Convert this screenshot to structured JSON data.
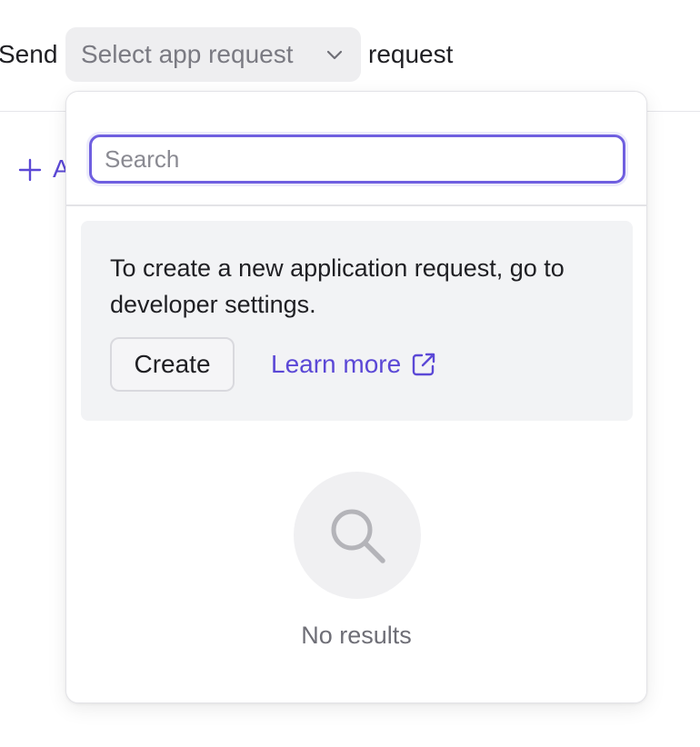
{
  "header": {
    "send_label": "Send",
    "request_label": "request",
    "select_placeholder": "Select app request",
    "chevron_icon": "chevron-down-icon"
  },
  "background": {
    "add_label": "A",
    "add_icon": "plus-icon"
  },
  "dropdown": {
    "search_placeholder": "Search",
    "search_value": "",
    "info_text": "To create a new application request, go to developer settings.",
    "create_label": "Create",
    "learn_more_label": "Learn more",
    "learn_more_icon": "external-link-icon",
    "empty_icon": "search-icon",
    "empty_text": "No results"
  },
  "colors": {
    "accent": "#5b48d6",
    "focus_ring": "#6f5fe0",
    "info_bg": "#f2f3f5",
    "trigger_bg": "#eeeef0"
  }
}
